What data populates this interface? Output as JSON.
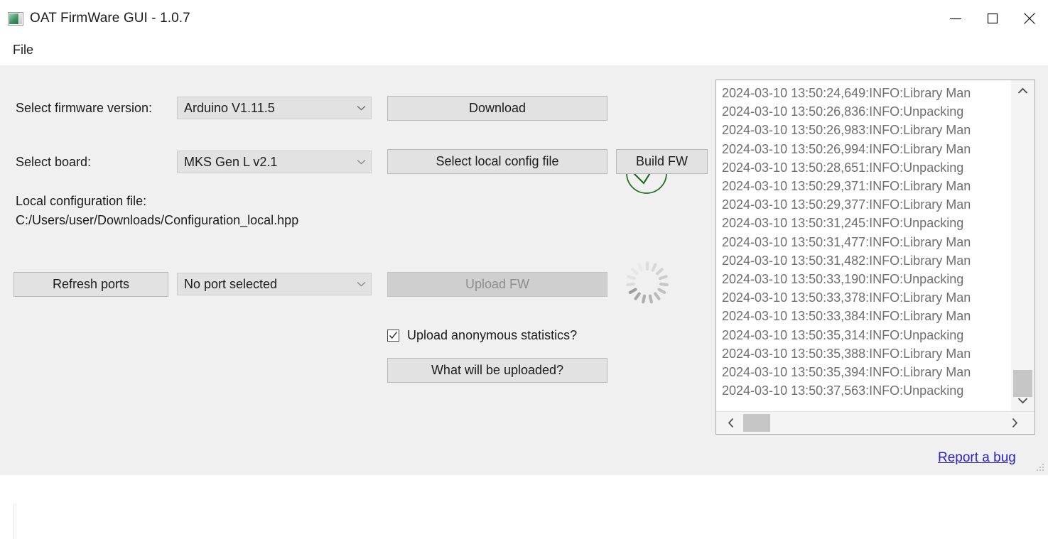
{
  "window": {
    "title": "OAT FirmWare GUI - 1.0.7",
    "icon": "app-window-icon",
    "minimize_label": "Minimize",
    "maximize_label": "Maximize",
    "close_label": "Close"
  },
  "menubar": {
    "items": [
      {
        "label": "File"
      }
    ]
  },
  "form": {
    "firmware_label": "Select firmware version:",
    "firmware_value": "Arduino V1.11.5",
    "board_label": "Select board:",
    "board_value": "MKS Gen L v2.1",
    "config_title": "Local configuration file:",
    "config_path": "C:/Users/user/Downloads/Configuration_local.hpp",
    "port_value": "No port selected"
  },
  "buttons": {
    "download": "Download",
    "select_local_config": "Select local config file",
    "build_fw": "Build FW",
    "refresh_ports": "Refresh ports",
    "upload_fw": "Upload FW",
    "what_will_be_uploaded": "What will be uploaded?"
  },
  "status": {
    "download_state_icon": "check-circle-icon",
    "build_state_icon": "spinner-icon",
    "check_color": "#1a6b1a",
    "spinner_color": "#b4b4b4"
  },
  "checkbox": {
    "label": "Upload anonymous statistics?",
    "checked": true
  },
  "log": {
    "lines": [
      "2024-03-10 13:50:24,649:INFO:Library Man",
      "2024-03-10 13:50:26,836:INFO:Unpacking",
      "2024-03-10 13:50:26,983:INFO:Library Man",
      "2024-03-10 13:50:26,994:INFO:Library Man",
      "2024-03-10 13:50:28,651:INFO:Unpacking",
      "2024-03-10 13:50:29,371:INFO:Library Man",
      "2024-03-10 13:50:29,377:INFO:Library Man",
      "2024-03-10 13:50:31,245:INFO:Unpacking",
      "2024-03-10 13:50:31,477:INFO:Library Man",
      "2024-03-10 13:50:31,482:INFO:Library Man",
      "2024-03-10 13:50:33,190:INFO:Unpacking",
      "2024-03-10 13:50:33,378:INFO:Library Man",
      "2024-03-10 13:50:33,384:INFO:Library Man",
      "2024-03-10 13:50:35,314:INFO:Unpacking",
      "2024-03-10 13:50:35,388:INFO:Library Man",
      "2024-03-10 13:50:35,394:INFO:Library Man",
      "2024-03-10 13:50:37,563:INFO:Unpacking"
    ],
    "text_color": "#6f6f6f"
  },
  "footer": {
    "report_bug": "Report a bug",
    "link_color": "#2a23c8"
  }
}
